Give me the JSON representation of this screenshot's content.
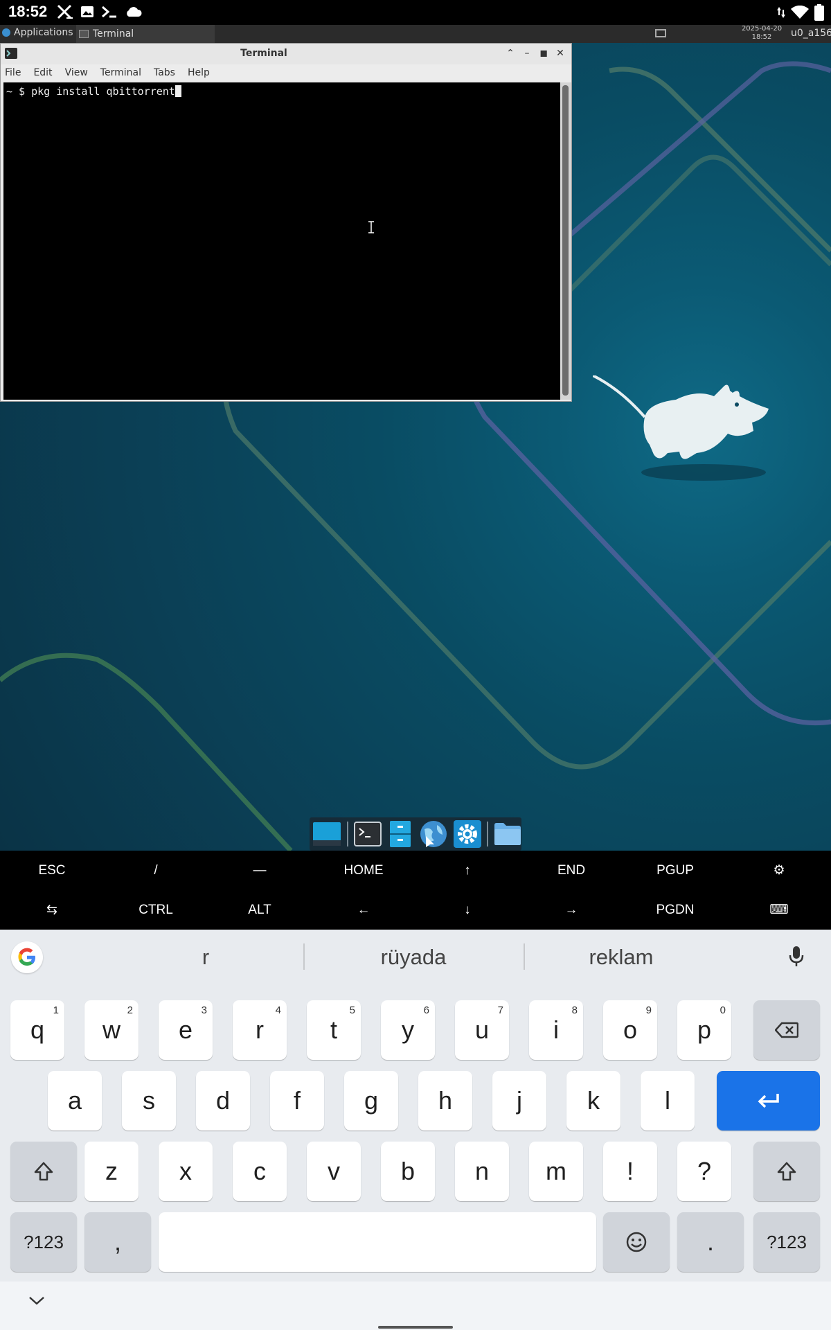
{
  "status_bar": {
    "time": "18:52",
    "icons_left": [
      "x-icon",
      "image-icon",
      "terminal-prompt-icon",
      "cloud-icon"
    ],
    "icons_right": [
      "data-arrows-icon",
      "wifi-icon",
      "battery-icon"
    ]
  },
  "top_panel": {
    "applications_label": "Applications",
    "task_label": "Terminal",
    "clock_date": "2025-04-20",
    "clock_time": "18:52",
    "user": "u0_a156"
  },
  "terminal": {
    "title": "Terminal",
    "menu": [
      "File",
      "Edit",
      "View",
      "Terminal",
      "Tabs",
      "Help"
    ],
    "prompt": "~ $",
    "command": " pkg install qbittorrent"
  },
  "dock": {
    "items": [
      "show-desktop-icon",
      "terminal-icon",
      "file-cabinet-icon",
      "web-browser-icon",
      "settings-icon",
      "folder-icon"
    ]
  },
  "extra_keys": {
    "row1": [
      "ESC",
      "/",
      "—",
      "HOME",
      "↑",
      "END",
      "PGUP",
      "⚙"
    ],
    "row2": [
      "⇆",
      "CTRL",
      "ALT",
      "←",
      "↓",
      "→",
      "PGDN",
      "⌨"
    ]
  },
  "keyboard": {
    "suggestions": [
      "r",
      "rüyada",
      "reklam"
    ],
    "row1": [
      {
        "k": "q",
        "h": "1"
      },
      {
        "k": "w",
        "h": "2"
      },
      {
        "k": "e",
        "h": "3"
      },
      {
        "k": "r",
        "h": "4"
      },
      {
        "k": "t",
        "h": "5"
      },
      {
        "k": "y",
        "h": "6"
      },
      {
        "k": "u",
        "h": "7"
      },
      {
        "k": "i",
        "h": "8"
      },
      {
        "k": "o",
        "h": "9"
      },
      {
        "k": "p",
        "h": "0"
      }
    ],
    "row2": [
      "a",
      "s",
      "d",
      "f",
      "g",
      "h",
      "j",
      "k",
      "l"
    ],
    "row3": [
      "z",
      "x",
      "c",
      "v",
      "b",
      "n",
      "m",
      "!",
      "?"
    ],
    "symbols_label": "?123",
    "comma": ",",
    "period": "."
  },
  "colors": {
    "enter_key": "#1a73e8",
    "desktop_bg": "#0b4a62"
  }
}
